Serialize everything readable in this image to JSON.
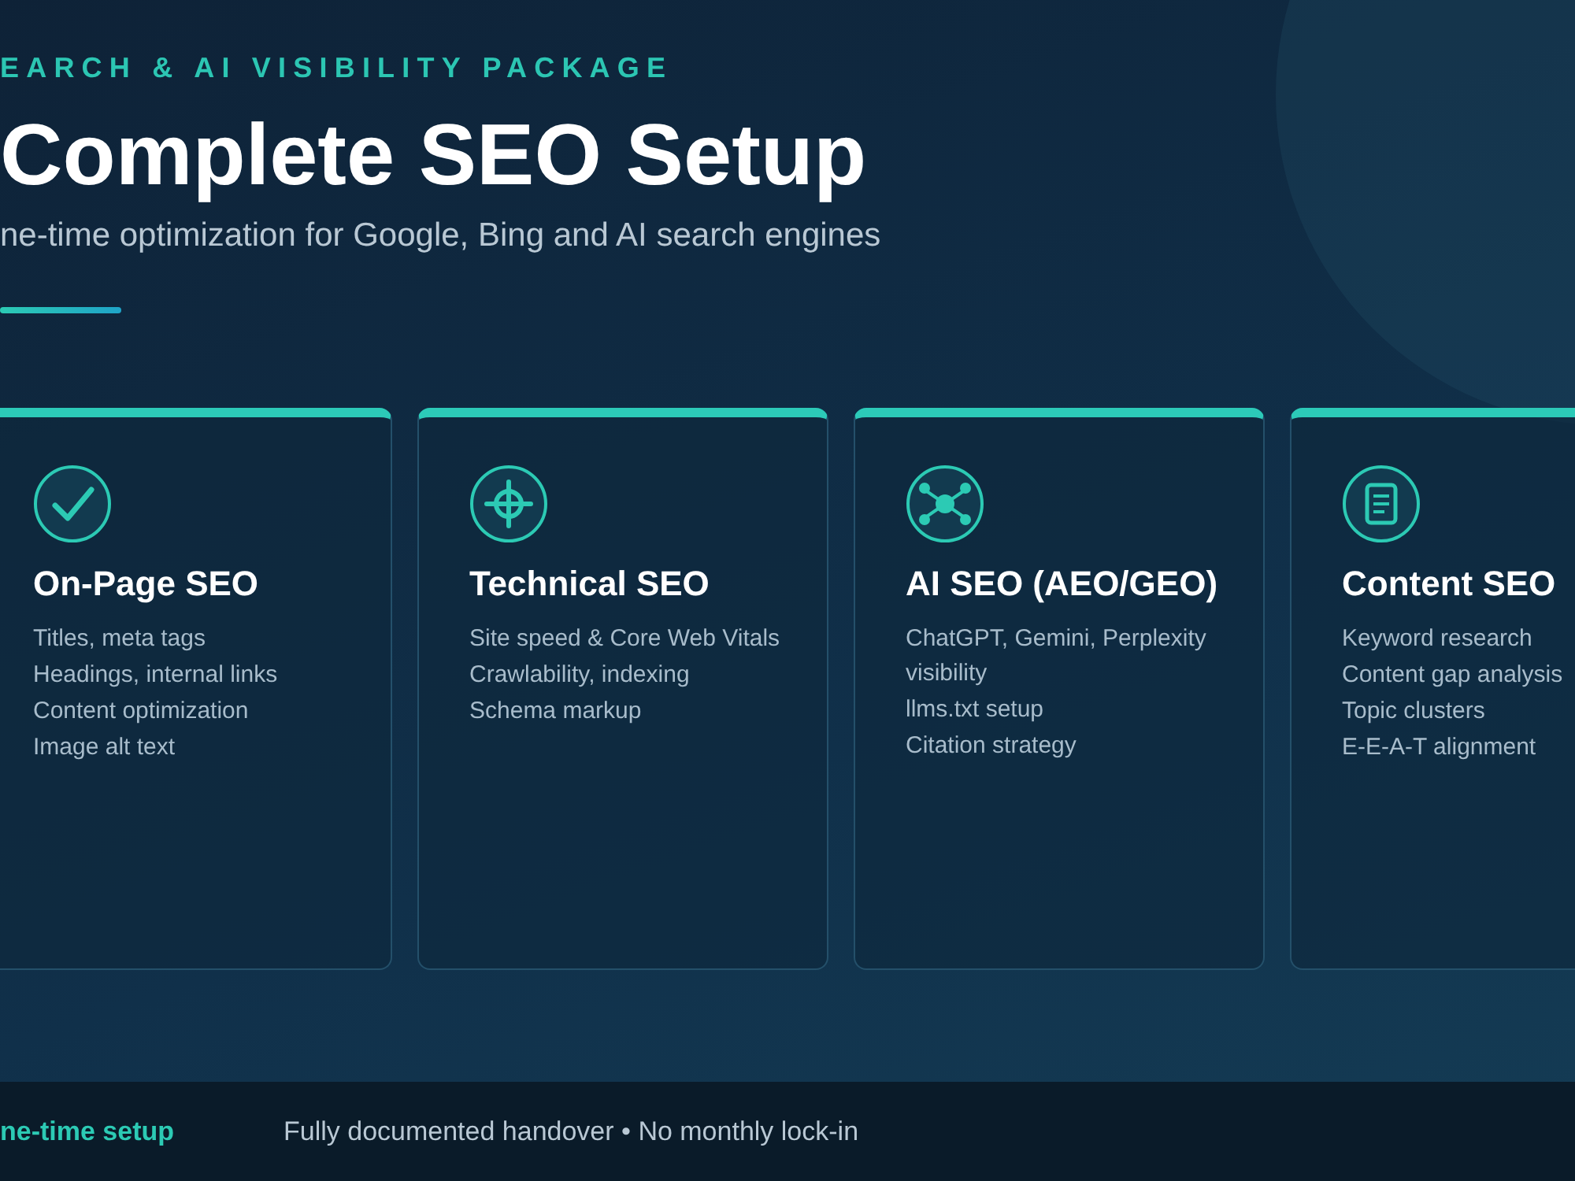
{
  "eyebrow": "EARCH & AI VISIBILITY PACKAGE",
  "title": "Complete SEO Setup",
  "subtitle": "ne-time optimization for Google, Bing and AI search engines",
  "cards": [
    {
      "title": "On-Page SEO",
      "items": [
        "Titles, meta tags",
        "Headings, internal links",
        "Content optimization",
        "Image alt text"
      ]
    },
    {
      "title": "Technical SEO",
      "items": [
        "Site speed & Core Web Vitals",
        "Crawlability, indexing",
        "Schema markup"
      ]
    },
    {
      "title": "AI SEO (AEO/GEO)",
      "items": [
        "ChatGPT, Gemini, Perplexity visibility",
        "llms.txt setup",
        "Citation strategy"
      ]
    },
    {
      "title": "Content SEO",
      "items": [
        "Keyword research",
        "Content gap analysis",
        "Topic clusters",
        "E-E-A-T alignment"
      ]
    }
  ],
  "footer": {
    "highlight": "ne-time setup",
    "text": "Fully documented handover • No monthly lock-in"
  }
}
